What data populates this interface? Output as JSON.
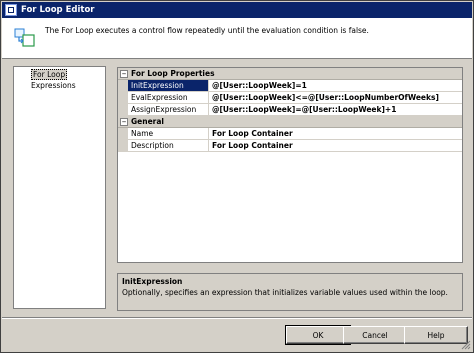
{
  "window": {
    "title": "For Loop Editor"
  },
  "header": {
    "description": "The For Loop executes a control flow repeatedly until the evaluation condition is false."
  },
  "nav": {
    "items": [
      {
        "label": "For Loop",
        "selected": true
      },
      {
        "label": "Expressions",
        "selected": false
      }
    ]
  },
  "grid": {
    "categories": [
      {
        "label": "For Loop Properties",
        "expanded": true,
        "properties": [
          {
            "name": "InitExpression",
            "value": "@[User::LoopWeek]=1",
            "selected": true
          },
          {
            "name": "EvalExpression",
            "value": "@[User::LoopWeek]<=@[User::LoopNumberOfWeeks]",
            "selected": false
          },
          {
            "name": "AssignExpression",
            "value": "@[User::LoopWeek]=@[User::LoopWeek]+1",
            "selected": false
          }
        ]
      },
      {
        "label": "General",
        "expanded": true,
        "properties": [
          {
            "name": "Name",
            "value": "For Loop Container",
            "selected": false
          },
          {
            "name": "Description",
            "value": "For Loop Container",
            "selected": false
          }
        ]
      }
    ],
    "toggle_symbol": "−"
  },
  "description_pane": {
    "title": "InitExpression",
    "text": "Optionally, specifies an expression that initializes variable values used within the loop."
  },
  "buttons": {
    "ok": "OK",
    "cancel": "Cancel",
    "help": "Help"
  },
  "colors": {
    "titlebar": "#0a246a",
    "selection": "#0a246a",
    "dialog_face": "#d4d0c8"
  },
  "icons": {
    "header": "for-loop-container-icon",
    "title": "dialog-app-icon"
  }
}
